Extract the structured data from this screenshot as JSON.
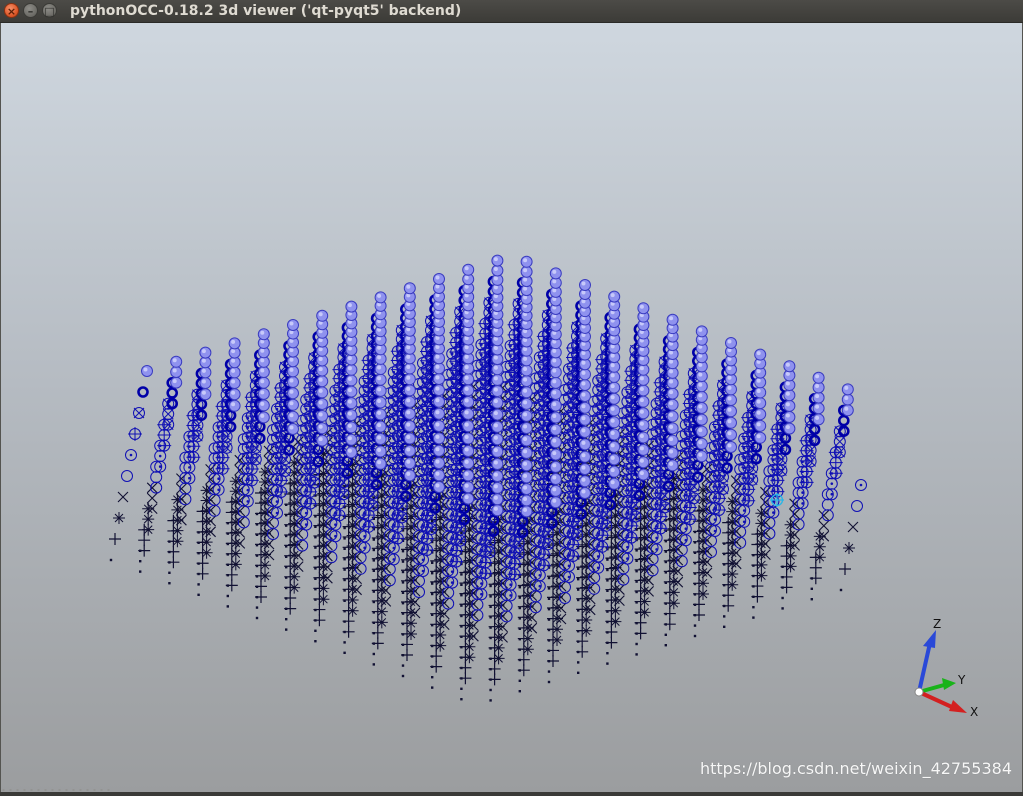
{
  "window": {
    "title": "pythonOCC-0.18.2 3d viewer ('qt-pyqt5' backend)",
    "buttons": {
      "close": "×",
      "minimize": "–",
      "maximize": "□"
    }
  },
  "viewer": {
    "background_top": "#cfd7df",
    "background_bottom": "#9b9d9f",
    "point_color_blue": "#1010b4",
    "point_color_dark": "#111133",
    "highlight_color": "#27b6e8"
  },
  "triedron": {
    "z_label": "Z",
    "y_label": "Y",
    "x_label": "X",
    "z_color": "#2a49d8",
    "y_color": "#19b319",
    "x_color": "#d32020"
  },
  "watermark": "https://blog.csdn.net/weixin_42755384"
}
